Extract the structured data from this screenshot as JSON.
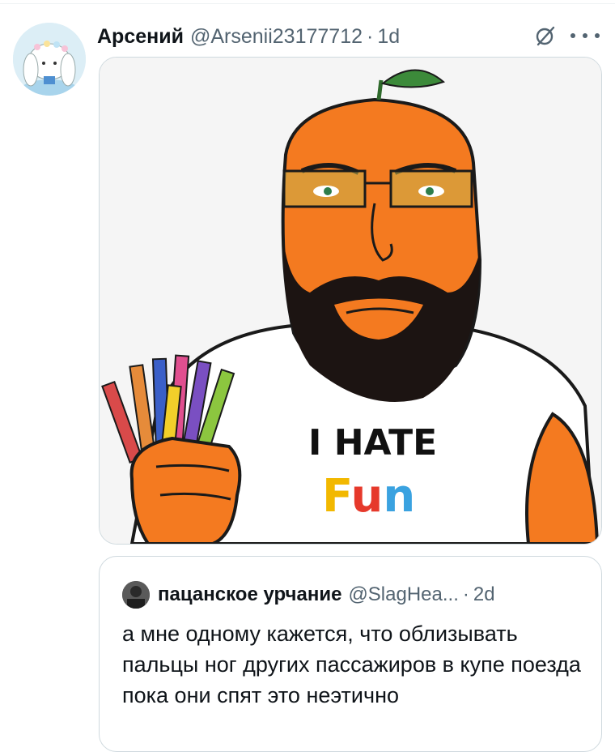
{
  "tweet": {
    "author_name": "Арсений",
    "author_handle": "@Arsenii23177712",
    "separator": "·",
    "time": "1d",
    "grok_icon": "grok-slash-circle-icon",
    "more_icon": "more-horizontal-icon"
  },
  "media": {
    "description_icon": "meme-image",
    "shirt_line1": "I HATE",
    "shirt_line2": "Fun",
    "colors": {
      "skin": "#f47a20",
      "beard": "#1c1412",
      "shirt": "#ffffff",
      "leaf": "#3c8a3a",
      "outline": "#1a1a1a"
    },
    "fun_letter_colors": [
      "#f2b800",
      "#e6392b",
      "#3aa2e0",
      "#9b3fcf"
    ]
  },
  "quoted_tweet": {
    "author_name": "пацанское урчание",
    "author_handle": "@SlagHea...",
    "separator": "·",
    "time": "2d",
    "text": "а мне одному кажется, что облизывать пальцы ног других пассажиров в купе поезда пока они спят это неэтично"
  },
  "colors": {
    "text_primary": "#0f1419",
    "text_secondary": "#536471",
    "border": "#cfd9de"
  }
}
